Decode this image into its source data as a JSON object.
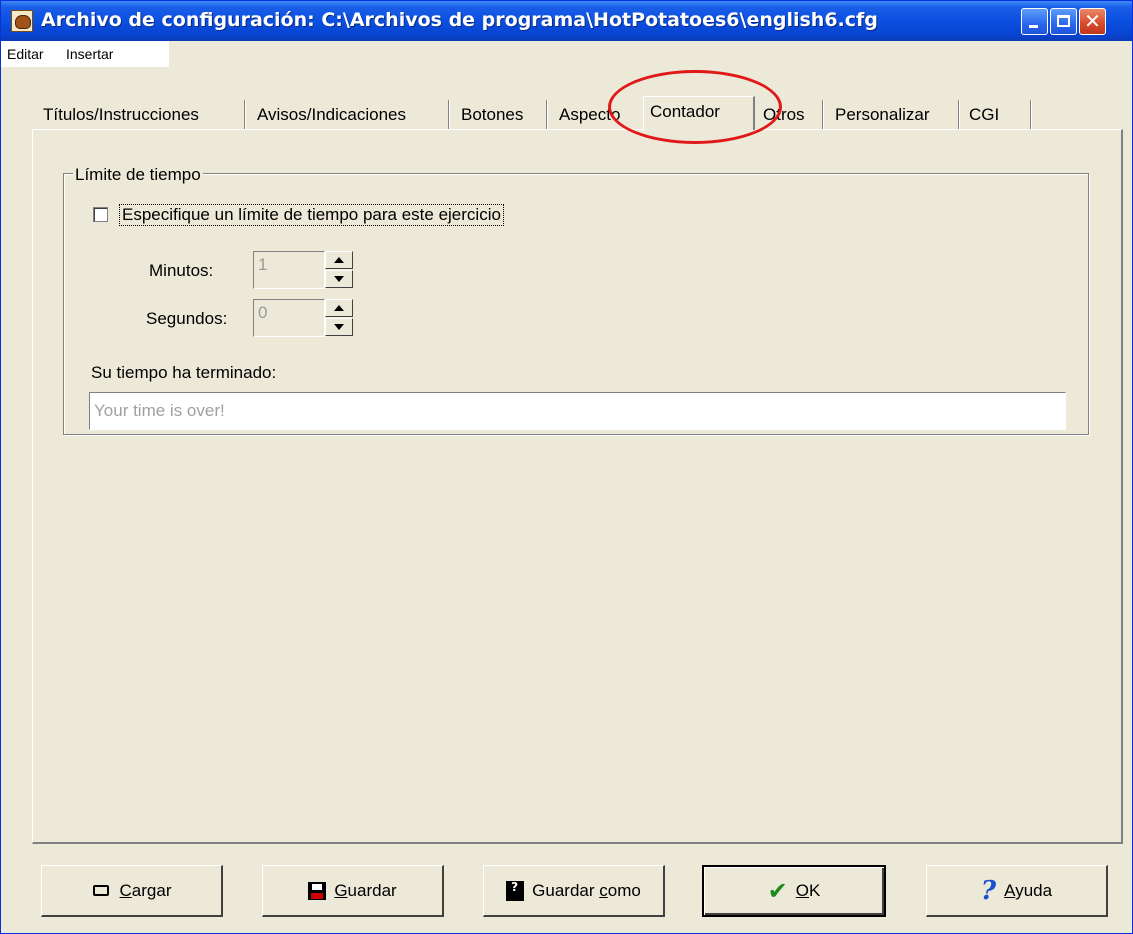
{
  "window": {
    "title": "Archivo de configuración: C:\\Archivos de programa\\HotPotatoes6\\english6.cfg"
  },
  "menu": {
    "items": [
      "Editar",
      "Insertar"
    ]
  },
  "tabs": [
    {
      "label": "Títulos/Instrucciones"
    },
    {
      "label": "Avisos/Indicaciones"
    },
    {
      "label": "Botones"
    },
    {
      "label": "Aspecto"
    },
    {
      "label": "Contador",
      "active": true
    },
    {
      "label": "Otros"
    },
    {
      "label": "Personalizar"
    },
    {
      "label": "CGI"
    }
  ],
  "timer": {
    "group_title": "Límite de tiempo",
    "checkbox_label": "Especifique un límite de tiempo para este ejercicio",
    "checkbox_checked": false,
    "minutes_label": "Minutos:",
    "minutes_value": "1",
    "seconds_label": "Segundos:",
    "seconds_value": "0",
    "timeout_label": "Su tiempo ha terminado:",
    "timeout_message": "Your time is over!"
  },
  "buttons": {
    "load_prefix": "",
    "load_ul": "C",
    "load_rest": "argar",
    "save_ul": "G",
    "save_rest": "uardar",
    "saveas_prefix": "Guardar ",
    "saveas_ul": "c",
    "saveas_rest": "omo",
    "ok_ul": "O",
    "ok_rest": "K",
    "help_ul": "A",
    "help_rest": "yuda"
  },
  "colors": {
    "titlebar": "#0a50e0",
    "face": "#ece9d8",
    "highlight_annotation": "#e01818"
  }
}
